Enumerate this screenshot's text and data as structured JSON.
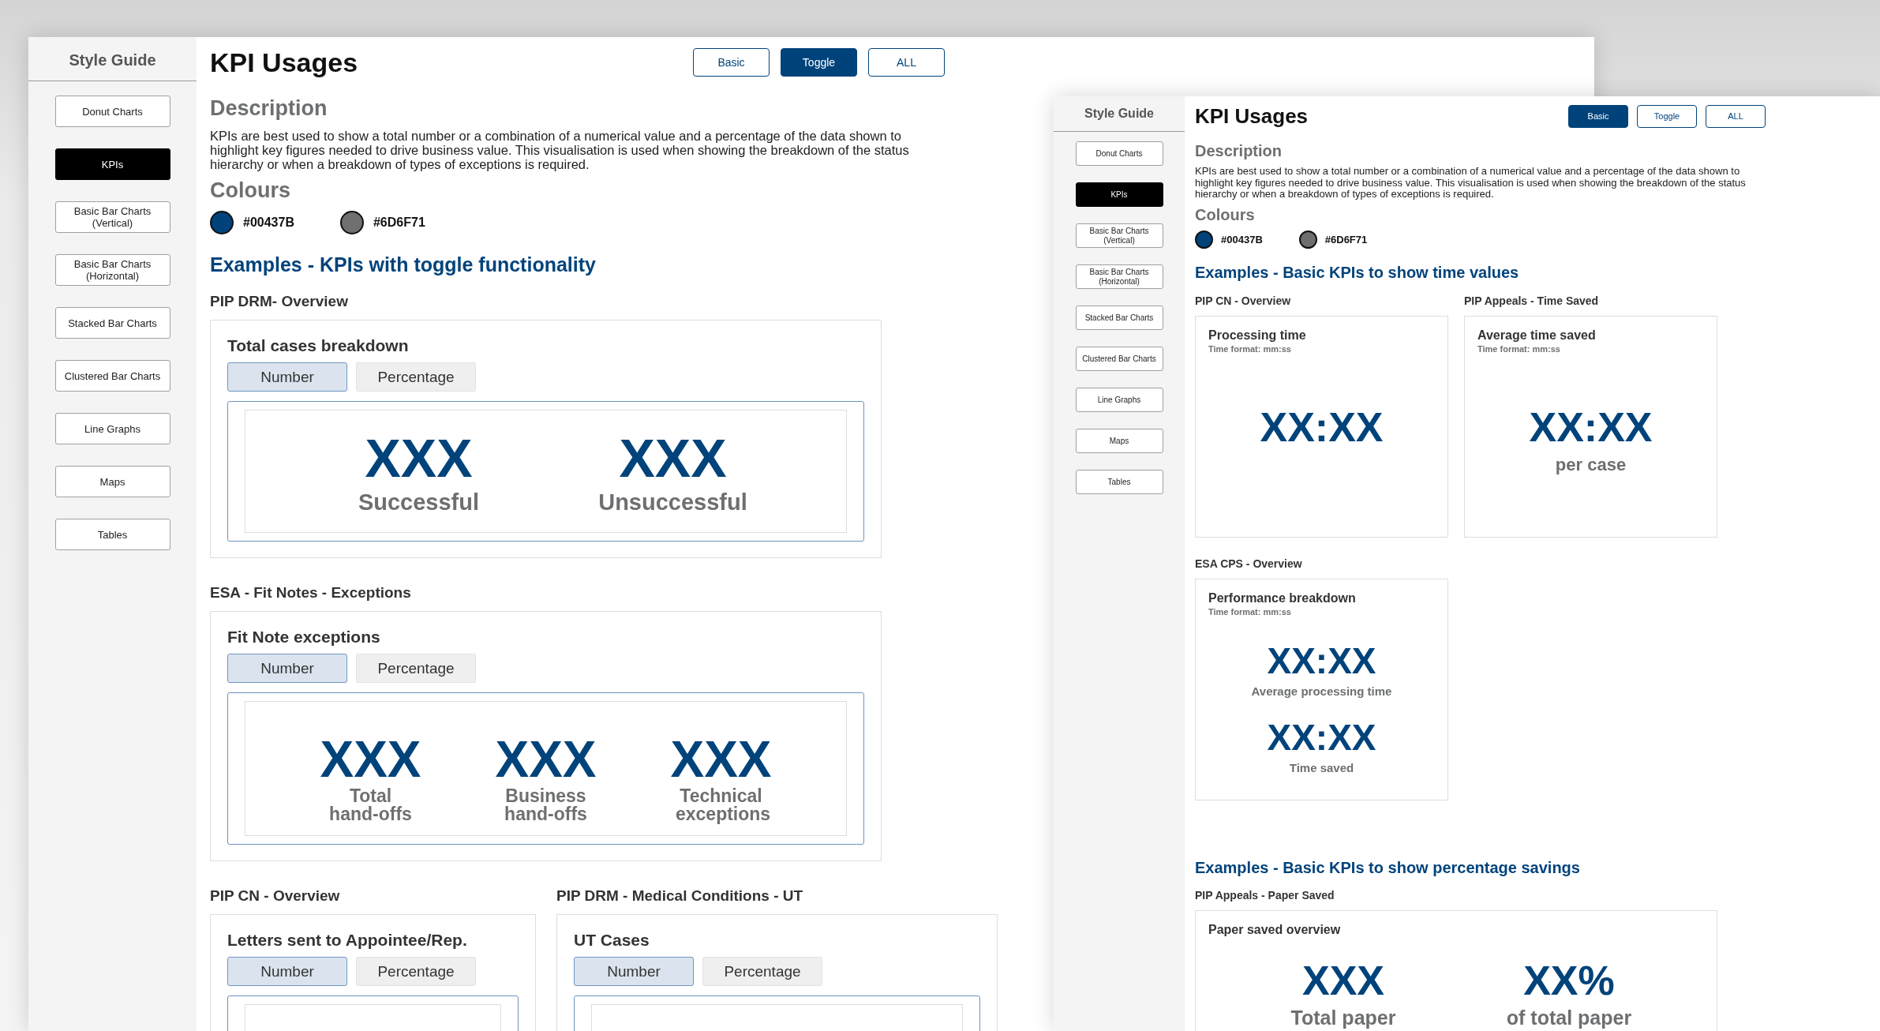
{
  "windows": [
    {
      "sidebar": {
        "title": "Style Guide",
        "items": [
          {
            "label": "Donut Charts",
            "selected": false
          },
          {
            "label": "KPIs",
            "selected": true
          },
          {
            "label": "Basic Bar Charts (Vertical)",
            "selected": false
          },
          {
            "label": "Basic Bar Charts (Horizontal)",
            "selected": false
          },
          {
            "label": "Stacked Bar Charts",
            "selected": false
          },
          {
            "label": "Clustered Bar Charts",
            "selected": false
          },
          {
            "label": "Line Graphs",
            "selected": false
          },
          {
            "label": "Maps",
            "selected": false
          },
          {
            "label": "Tables",
            "selected": false
          }
        ]
      },
      "title": "KPI Usages",
      "view_buttons": [
        {
          "label": "Basic",
          "selected": false
        },
        {
          "label": "Toggle",
          "selected": true
        },
        {
          "label": "ALL",
          "selected": false
        }
      ],
      "description": {
        "heading": "Description",
        "text": "KPIs are best used to show a total number or a combination of a numerical value and a percentage of the data shown to highlight key figures needed to drive business value. This visualisation is used when showing the breakdown of the status hierarchy or when a breakdown of types of exceptions is required."
      },
      "colours": {
        "heading": "Colours",
        "swatches": [
          {
            "label": "#00437B",
            "color": "#00437b"
          },
          {
            "label": "#6D6F71",
            "color": "#6d6f71"
          }
        ]
      },
      "sections": [
        {
          "heading": "Examples - KPIs with toggle functionality",
          "rows": [
            [
              {
                "caption": "PIP DRM- Overview",
                "kind": "toggle",
                "stacked": false,
                "title": "Total cases breakdown",
                "toggle": [
                  {
                    "label": "Number",
                    "selected": true
                  },
                  {
                    "label": "Percentage",
                    "selected": false
                  }
                ],
                "kpis": [
                  {
                    "value": "XXX",
                    "label": "Successful"
                  },
                  {
                    "value": "XXX",
                    "label": "Unsuccessful"
                  }
                ]
              }
            ],
            [
              {
                "caption": "ESA - Fit Notes - Exceptions",
                "kind": "toggle",
                "stacked": false,
                "title": "Fit Note exceptions",
                "toggle": [
                  {
                    "label": "Number",
                    "selected": true
                  },
                  {
                    "label": "Percentage",
                    "selected": false
                  }
                ],
                "kpis": [
                  {
                    "value": "XXX",
                    "label": "Total hand-offs"
                  },
                  {
                    "value": "XXX",
                    "label": "Business hand-offs"
                  },
                  {
                    "value": "XXX",
                    "label": "Technical exceptions"
                  }
                ]
              }
            ],
            [
              {
                "caption": "PIP CN - Overview",
                "kind": "toggle",
                "title": "Letters sent to Appointee/Rep.",
                "toggle": [
                  {
                    "label": "Number",
                    "selected": true
                  },
                  {
                    "label": "Percentage",
                    "selected": false
                  }
                ]
              },
              {
                "caption": "PIP DRM - Medical Conditions - UT",
                "kind": "toggle",
                "title": "UT Cases",
                "toggle": [
                  {
                    "label": "Number",
                    "selected": true
                  },
                  {
                    "label": "Percentage",
                    "selected": false
                  }
                ]
              }
            ]
          ]
        }
      ]
    },
    {
      "sidebar": {
        "title": "Style Guide",
        "items": [
          {
            "label": "Donut Charts",
            "selected": false
          },
          {
            "label": "KPIs",
            "selected": true
          },
          {
            "label": "Basic Bar Charts (Vertical)",
            "selected": false
          },
          {
            "label": "Basic Bar Charts (Horizontal)",
            "selected": false
          },
          {
            "label": "Stacked Bar Charts",
            "selected": false
          },
          {
            "label": "Clustered Bar Charts",
            "selected": false
          },
          {
            "label": "Line Graphs",
            "selected": false
          },
          {
            "label": "Maps",
            "selected": false
          },
          {
            "label": "Tables",
            "selected": false
          }
        ]
      },
      "title": "KPI Usages",
      "view_buttons": [
        {
          "label": "Basic",
          "selected": true
        },
        {
          "label": "Toggle",
          "selected": false
        },
        {
          "label": "ALL",
          "selected": false
        }
      ],
      "description": {
        "heading": "Description",
        "text": "KPIs are best used to show a total number or a combination of a numerical value and a percentage of the data shown to highlight key figures needed to drive business value. This visualisation is used when showing the breakdown of the status hierarchy or when a breakdown of types of exceptions is required."
      },
      "colours": {
        "heading": "Colours",
        "swatches": [
          {
            "label": "#00437B",
            "color": "#00437b"
          },
          {
            "label": "#6D6F71",
            "color": "#6d6f71"
          }
        ]
      },
      "sections": [
        {
          "heading": "Examples - Basic KPIs to show time values",
          "rows": [
            [
              {
                "caption": "PIP CN - Overview",
                "kind": "basic",
                "stacked": false,
                "title": "Processing time",
                "subtitle": "Time format: mm:ss",
                "kpis": [
                  {
                    "value": "XX:XX"
                  }
                ]
              },
              {
                "caption": "PIP Appeals - Time Saved",
                "kind": "basic",
                "stacked": false,
                "title": "Average time saved",
                "subtitle": "Time format: mm:ss",
                "kpis": [
                  {
                    "value": "XX:XX",
                    "label": "per case"
                  }
                ]
              }
            ],
            [
              {
                "caption": "ESA CPS - Overview",
                "kind": "basic",
                "stacked": true,
                "title": "Performance breakdown",
                "subtitle": "Time format: mm:ss",
                "kpis": [
                  {
                    "value": "XX:XX",
                    "label": "Average processing time"
                  },
                  {
                    "value": "XX:XX",
                    "label": "Time saved"
                  }
                ]
              }
            ]
          ]
        },
        {
          "heading": "Examples - Basic KPIs to show percentage savings",
          "rows": [
            [
              {
                "caption": "PIP Appeals - Paper Saved",
                "kind": "basic",
                "stacked": false,
                "title": "Paper saved overview",
                "kpis": [
                  {
                    "value": "XXX",
                    "label": "Total paper"
                  },
                  {
                    "value": "XX%",
                    "label": "of total paper"
                  }
                ]
              }
            ]
          ]
        }
      ]
    }
  ]
}
